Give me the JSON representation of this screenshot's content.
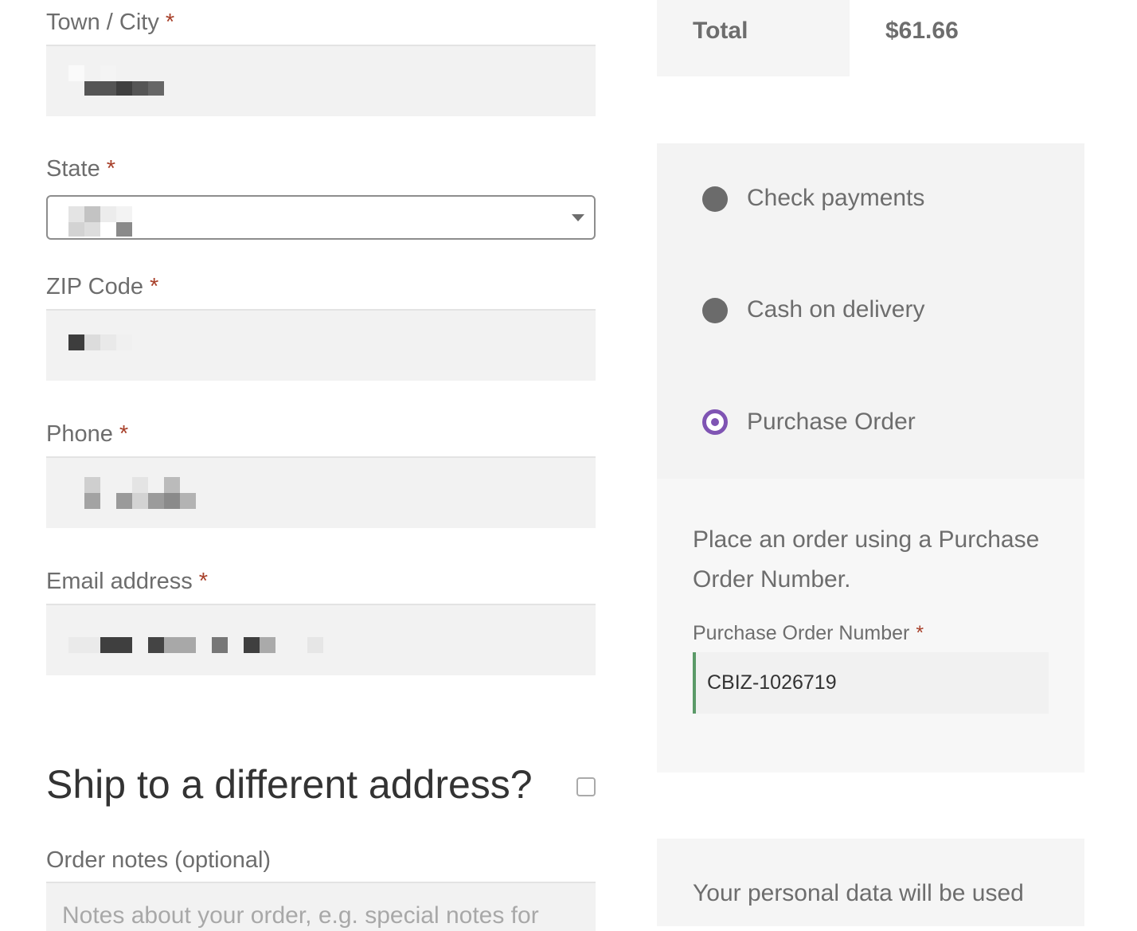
{
  "billing": {
    "city": {
      "label": "Town / City",
      "required": "*"
    },
    "state": {
      "label": "State",
      "required": "*"
    },
    "zip": {
      "label": "ZIP Code",
      "required": "*"
    },
    "phone": {
      "label": "Phone",
      "required": "*"
    },
    "email": {
      "label": "Email address",
      "required": "*"
    }
  },
  "shipping": {
    "title": "Ship to a different address?"
  },
  "notes": {
    "label": "Order notes (optional)",
    "placeholder": "Notes about your order, e.g. special notes for"
  },
  "order_total": {
    "label": "Total",
    "value": "$61.66"
  },
  "payment": {
    "methods": [
      {
        "label": "Check payments",
        "selected": false
      },
      {
        "label": "Cash on delivery",
        "selected": false
      },
      {
        "label": "Purchase Order",
        "selected": true
      }
    ],
    "description": "Place an order using a Purchase Order Number.",
    "po_field": {
      "label": "Purchase Order Number",
      "required": "*",
      "value": "CBIZ-1026719"
    }
  },
  "privacy": {
    "text": "Your personal data will be used"
  },
  "colors": {
    "accent": "#7f54b3",
    "required": "#a8412b",
    "field_bg": "#f2f2f2",
    "valid_border": "#5b9a68"
  }
}
